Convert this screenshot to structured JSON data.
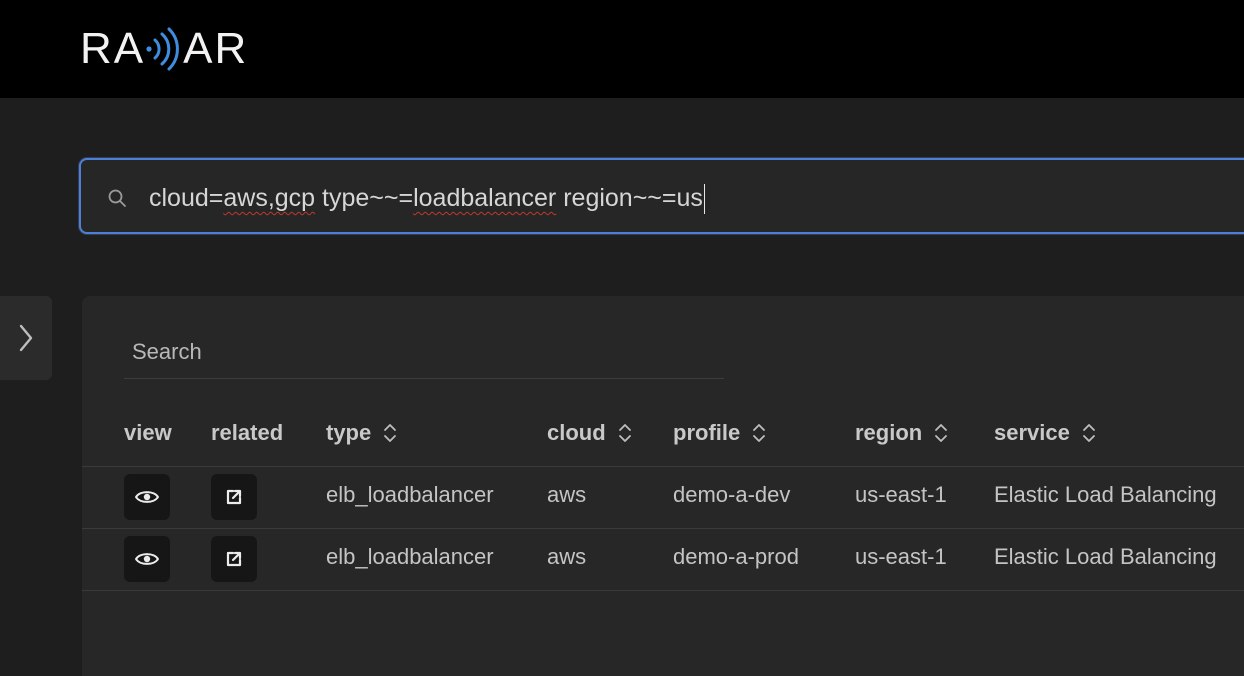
{
  "header": {
    "logo_text_left": "RA",
    "logo_text_right": "AR",
    "logo_icon": "radio-signal-icon"
  },
  "query": {
    "segments": [
      {
        "text": "cloud=",
        "squiggle": false
      },
      {
        "text": "aws,gcp",
        "squiggle": true
      },
      {
        "text": " type~~=",
        "squiggle": false
      },
      {
        "text": "loadbalancer",
        "squiggle": true
      },
      {
        "text": " region~~=us",
        "squiggle": false
      }
    ],
    "icon": "search-icon"
  },
  "sidebar": {
    "toggle_icon": "chevron-right-icon"
  },
  "table": {
    "search_placeholder": "Search",
    "columns": [
      {
        "key": "view",
        "label": "view",
        "sortable": false
      },
      {
        "key": "related",
        "label": "related",
        "sortable": false
      },
      {
        "key": "type",
        "label": "type",
        "sortable": true
      },
      {
        "key": "cloud",
        "label": "cloud",
        "sortable": true
      },
      {
        "key": "profile",
        "label": "profile",
        "sortable": true
      },
      {
        "key": "region",
        "label": "region",
        "sortable": true
      },
      {
        "key": "service",
        "label": "service",
        "sortable": true
      }
    ],
    "rows": [
      {
        "type": "elb_loadbalancer",
        "cloud": "aws",
        "profile": "demo-a-dev",
        "region": "us-east-1",
        "service": "Elastic Load Balancing"
      },
      {
        "type": "elb_loadbalancer",
        "cloud": "aws",
        "profile": "demo-a-prod",
        "region": "us-east-1",
        "service": "Elastic Load Balancing"
      }
    ],
    "view_icon": "eye-icon",
    "related_icon": "external-link-icon"
  },
  "colors": {
    "accent": "#4d7fd6",
    "logo_signal": "#3f8de0",
    "background": "#1e1e1e",
    "topbar": "#000000"
  }
}
